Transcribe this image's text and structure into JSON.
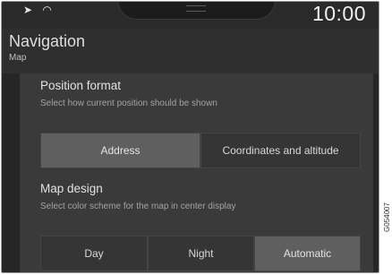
{
  "statusbar": {
    "icons": [
      "navigation-arrow-icon",
      "wifi-icon"
    ],
    "time": "10:00"
  },
  "header": {
    "title": "Navigation",
    "subtitle": "Map"
  },
  "position_format": {
    "title": "Position format",
    "description": "Select how current position should be shown",
    "options": [
      "Address",
      "Coordinates and altitude"
    ],
    "selected": "Address"
  },
  "map_design": {
    "title": "Map design",
    "description": "Select color scheme for the map in center display",
    "options": [
      "Day",
      "Night",
      "Automatic"
    ],
    "selected": "Automatic"
  },
  "figure_code": "G054007"
}
